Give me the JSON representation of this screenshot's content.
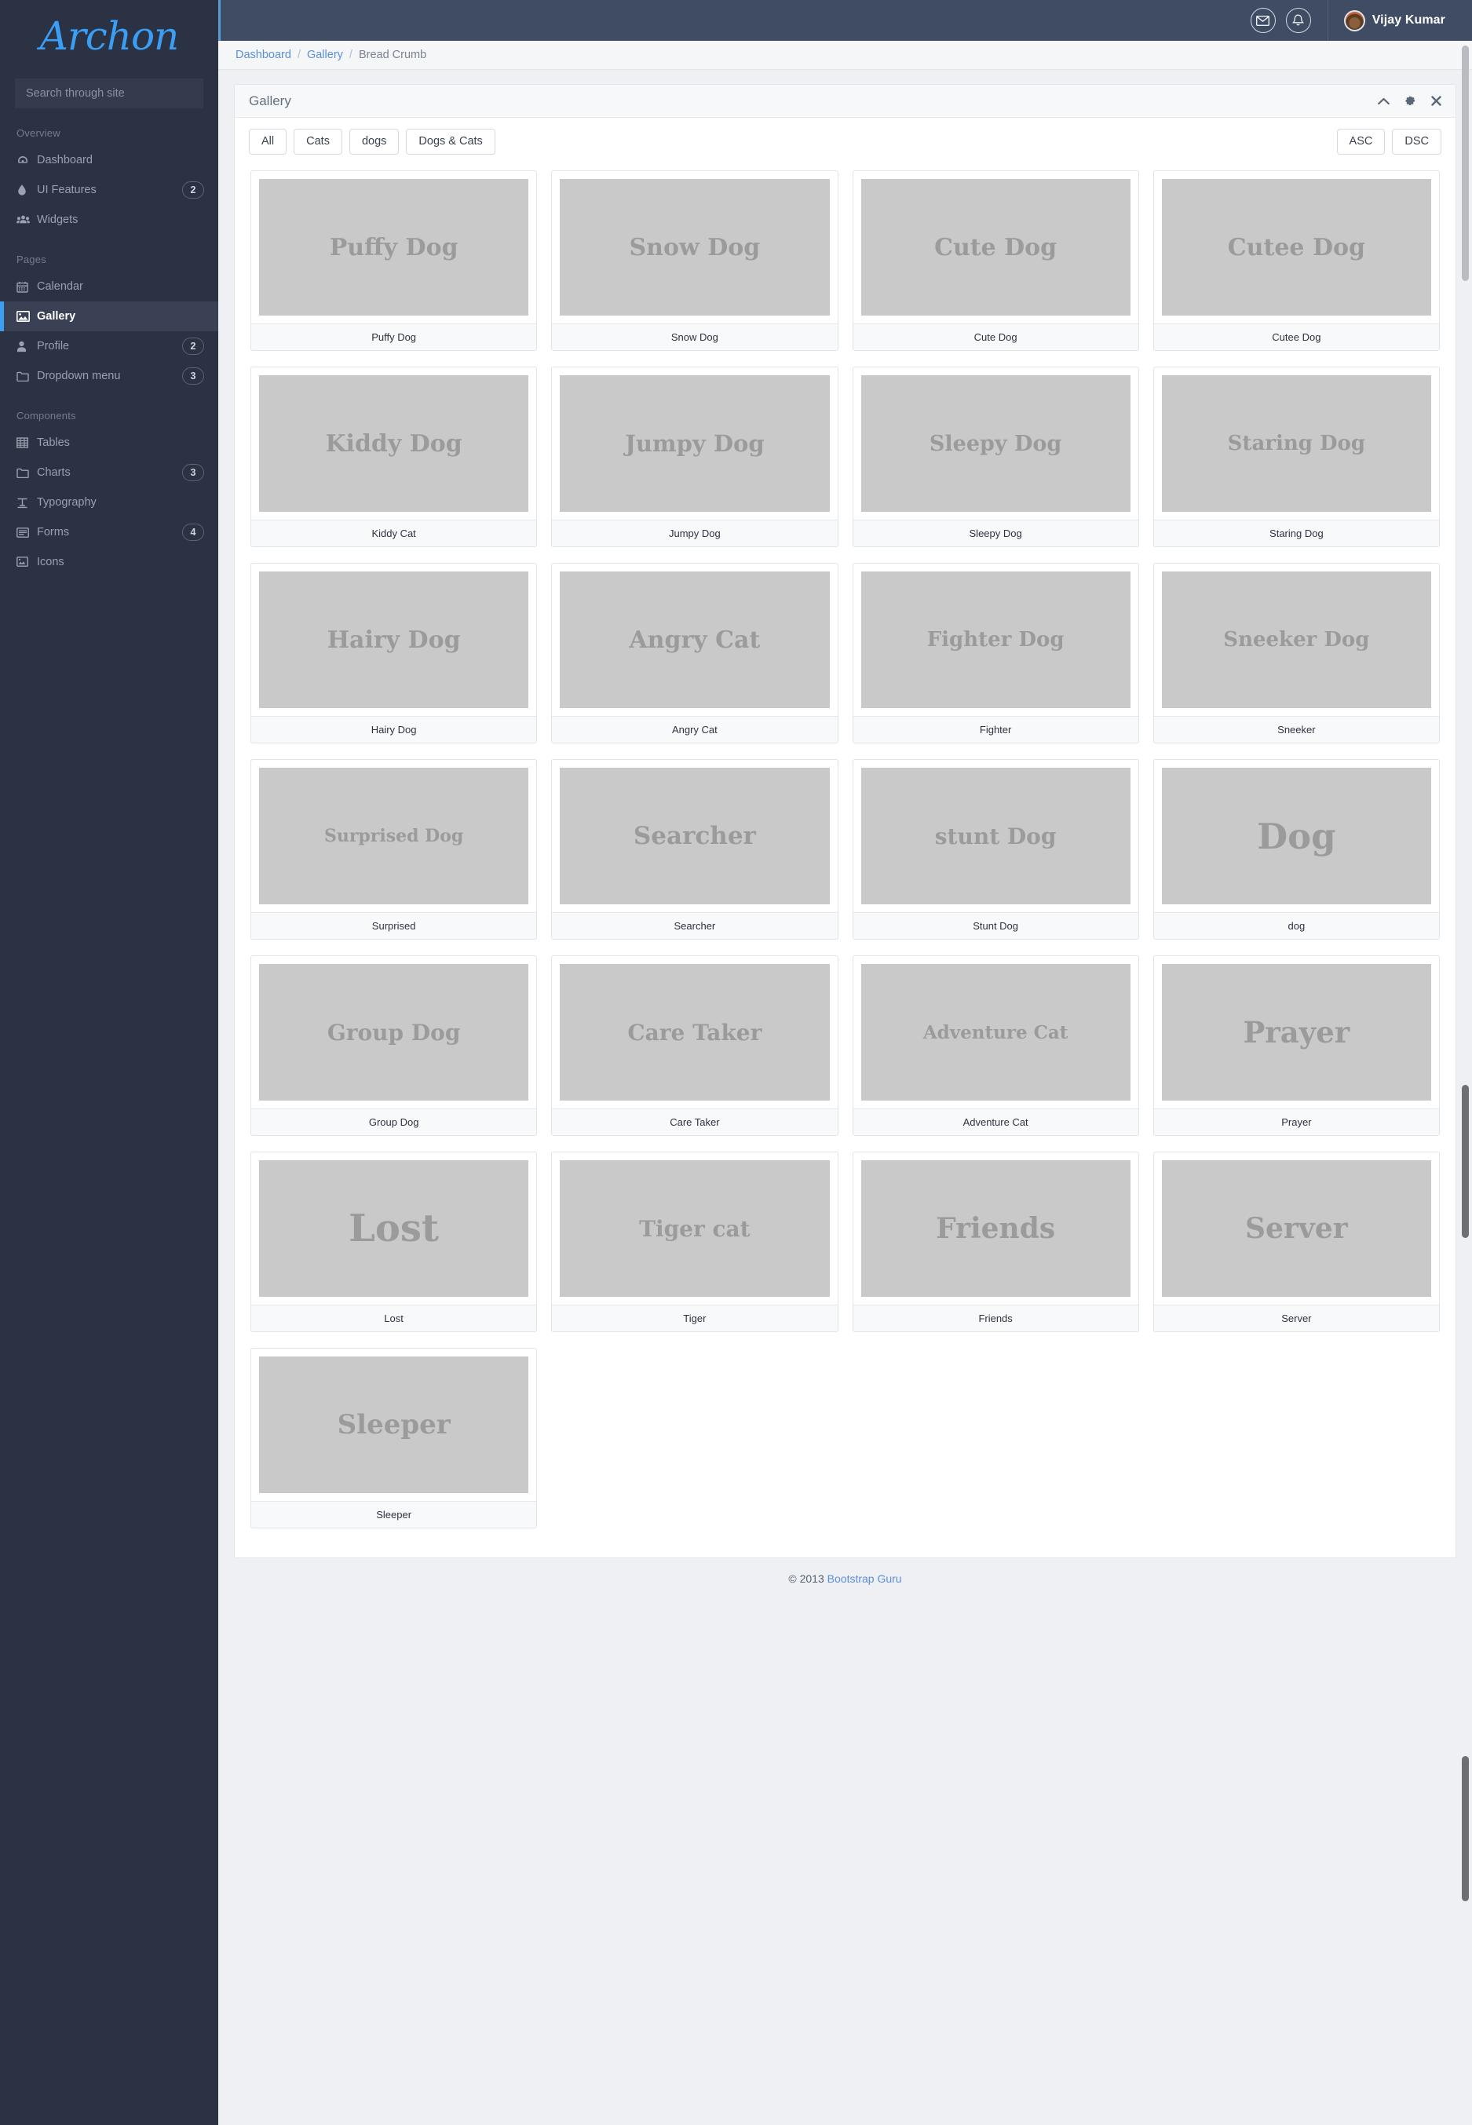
{
  "brand": {
    "logo_text": "Archon",
    "logo_color": "#3a9ef5"
  },
  "sidebar": {
    "search_placeholder": "Search through site",
    "sections": [
      {
        "title": "Overview",
        "items": [
          {
            "label": "Dashboard",
            "icon": "dashboard-icon",
            "badge": "",
            "active": false
          },
          {
            "label": "UI Features",
            "icon": "droplet-icon",
            "badge": "2",
            "active": false
          },
          {
            "label": "Widgets",
            "icon": "users-icon",
            "badge": "",
            "active": false
          }
        ]
      },
      {
        "title": "Pages",
        "items": [
          {
            "label": "Calendar",
            "icon": "calendar-icon",
            "badge": "",
            "active": false
          },
          {
            "label": "Gallery",
            "icon": "image-icon",
            "badge": "",
            "active": true
          },
          {
            "label": "Profile",
            "icon": "user-icon",
            "badge": "2",
            "active": false
          },
          {
            "label": "Dropdown menu",
            "icon": "folder-icon",
            "badge": "3",
            "active": false
          }
        ]
      },
      {
        "title": "Components",
        "items": [
          {
            "label": "Tables",
            "icon": "table-icon",
            "badge": "",
            "active": false
          },
          {
            "label": "Charts",
            "icon": "folder-icon",
            "badge": "3",
            "active": false
          },
          {
            "label": "Typography",
            "icon": "typography-icon",
            "badge": "",
            "active": false
          },
          {
            "label": "Forms",
            "icon": "forms-icon",
            "badge": "4",
            "active": false
          },
          {
            "label": "Icons",
            "icon": "icons-icon",
            "badge": "",
            "active": false
          }
        ]
      }
    ]
  },
  "topbar": {
    "mail_icon": "envelope-icon",
    "bell_icon": "bell-icon",
    "user_name": "Vijay Kumar",
    "avatar": "user-avatar"
  },
  "breadcrumb": {
    "items": [
      "Dashboard",
      "Gallery"
    ],
    "current": "Bread Crumb",
    "separator": "/"
  },
  "panel": {
    "title": "Gallery",
    "tools": [
      "chevron-up-icon",
      "gear-icon",
      "close-icon"
    ]
  },
  "filters": {
    "categories": [
      "All",
      "Cats",
      "dogs",
      "Dogs & Cats"
    ],
    "sort": [
      "ASC",
      "DSC"
    ]
  },
  "gallery": {
    "items": [
      {
        "image_text": "Puffy Dog",
        "caption": "Puffy Dog",
        "ph_size": 30
      },
      {
        "image_text": "Snow Dog",
        "caption": "Snow Dog",
        "ph_size": 30
      },
      {
        "image_text": "Cute Dog",
        "caption": "Cute Dog",
        "ph_size": 30
      },
      {
        "image_text": "Cutee Dog",
        "caption": "Cutee Dog",
        "ph_size": 30
      },
      {
        "image_text": "Kiddy Dog",
        "caption": "Kiddy Cat",
        "ph_size": 30
      },
      {
        "image_text": "Jumpy Dog",
        "caption": "Jumpy Dog",
        "ph_size": 29
      },
      {
        "image_text": "Sleepy Dog",
        "caption": "Sleepy Dog",
        "ph_size": 27
      },
      {
        "image_text": "Staring Dog",
        "caption": "Staring Dog",
        "ph_size": 26
      },
      {
        "image_text": "Hairy Dog",
        "caption": "Hairy Dog",
        "ph_size": 30
      },
      {
        "image_text": "Angry Cat",
        "caption": "Angry Cat",
        "ph_size": 30
      },
      {
        "image_text": "Fighter Dog",
        "caption": "Fighter",
        "ph_size": 26
      },
      {
        "image_text": "Sneeker Dog",
        "caption": "Sneeker",
        "ph_size": 26
      },
      {
        "image_text": "Surprised Dog",
        "caption": "Surprised",
        "ph_size": 22
      },
      {
        "image_text": "Searcher",
        "caption": "Searcher",
        "ph_size": 31
      },
      {
        "image_text": "stunt Dog",
        "caption": "Stunt Dog",
        "ph_size": 28
      },
      {
        "image_text": "Dog",
        "caption": "dog",
        "ph_size": 45
      },
      {
        "image_text": "Group Dog",
        "caption": "Group Dog",
        "ph_size": 28
      },
      {
        "image_text": "Care Taker",
        "caption": "Care Taker",
        "ph_size": 28
      },
      {
        "image_text": "Adventure Cat",
        "caption": "Adventure Cat",
        "ph_size": 23
      },
      {
        "image_text": "Prayer",
        "caption": "Prayer",
        "ph_size": 37
      },
      {
        "image_text": "Lost",
        "caption": "Lost",
        "ph_size": 48
      },
      {
        "image_text": "Tiger cat",
        "caption": "Tiger",
        "ph_size": 28
      },
      {
        "image_text": "Friends",
        "caption": "Friends",
        "ph_size": 36
      },
      {
        "image_text": "Server",
        "caption": "Server",
        "ph_size": 36
      },
      {
        "image_text": "Sleeper",
        "caption": "Sleeper",
        "ph_size": 34
      }
    ]
  },
  "footer": {
    "copyright": "© 2013 ",
    "link": "Bootstrap Guru"
  }
}
